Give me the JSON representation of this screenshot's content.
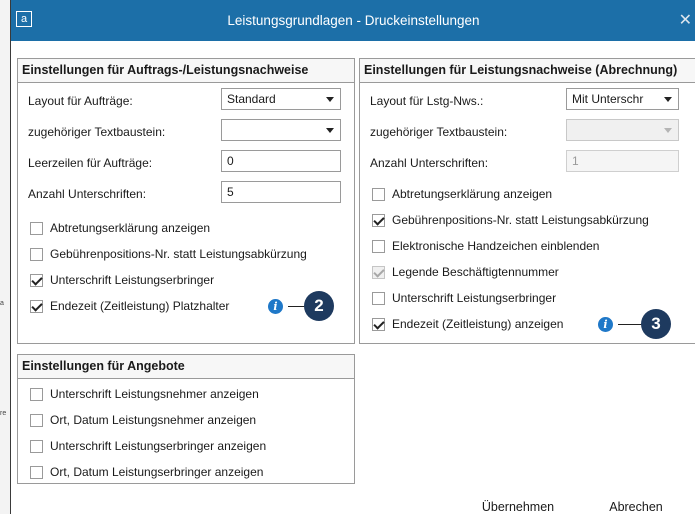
{
  "background": {
    "bits": [
      "a",
      "re"
    ]
  },
  "window": {
    "app_icon": "a",
    "title": "Leistungsgrundlagen - Druckeinstellungen",
    "close_glyph": "✕"
  },
  "left_group": {
    "title": "Einstellungen für Auftrags-/Leistungsnachweise",
    "layout_label": "Layout für Aufträge:",
    "layout_value": "Standard",
    "text_label": "zugehöriger Textbaustein:",
    "text_value": "",
    "blank_lines_label": "Leerzeilen für Aufträge:",
    "blank_lines_value": "0",
    "signatures_label": "Anzahl Unterschriften:",
    "signatures_value": "5",
    "checks": [
      {
        "label": "Abtretungserklärung anzeigen",
        "checked": false
      },
      {
        "label": "Gebührenpositions-Nr. statt Leistungsabkürzung",
        "checked": false
      },
      {
        "label": "Unterschrift Leistungserbringer",
        "checked": true
      },
      {
        "label": "Endezeit (Zeitleistung) Platzhalter",
        "checked": true
      }
    ]
  },
  "right_group": {
    "title": "Einstellungen für Leistungsnachweise (Abrechnung)",
    "layout_label": "Layout für Lstg-Nws.:",
    "layout_value": "Mit Unterschr",
    "text_label": "zugehöriger Textbaustein:",
    "text_value": "",
    "signatures_label": "Anzahl Unterschriften:",
    "signatures_value": "1",
    "checks": [
      {
        "label": "Abtretungserklärung anzeigen",
        "checked": false,
        "disabled": false
      },
      {
        "label": "Gebührenpositions-Nr. statt Leistungsabkürzung",
        "checked": true,
        "disabled": false
      },
      {
        "label": "Elektronische Handzeichen einblenden",
        "checked": false,
        "disabled": false
      },
      {
        "label": "Legende Beschäftigtennummer",
        "checked": true,
        "disabled": true
      },
      {
        "label": "Unterschrift Leistungserbringer",
        "checked": false,
        "disabled": false
      },
      {
        "label": "Endezeit (Zeitleistung) anzeigen",
        "checked": true,
        "disabled": false
      }
    ]
  },
  "offers_group": {
    "title": "Einstellungen für Angebote",
    "checks": [
      {
        "label": "Unterschrift Leistungsnehmer anzeigen",
        "checked": false
      },
      {
        "label": "Ort, Datum Leistungsnehmer anzeigen",
        "checked": false
      },
      {
        "label": "Unterschrift Leistungserbringer anzeigen",
        "checked": false
      },
      {
        "label": "Ort, Datum Leistungserbringer anzeigen",
        "checked": false
      }
    ]
  },
  "info_glyph": "i",
  "callouts": {
    "left": "2",
    "right": "3"
  },
  "buttons": {
    "apply": "Übernehmen",
    "cancel": "Abrechen"
  },
  "colors": {
    "titlebar": "#1c6fa8",
    "info": "#1f78c8",
    "callout": "#1e3a5f"
  },
  "icons": {
    "info": "info-icon",
    "close": "close-icon",
    "dropdown": "chevron-down-icon"
  }
}
